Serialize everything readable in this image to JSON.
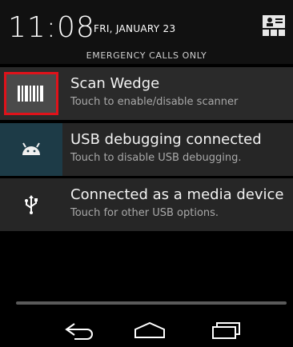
{
  "status_bar": {
    "time": "11:08",
    "date": "FRI, JANUARY 23",
    "emergency": "EMERGENCY CALLS ONLY",
    "quick_settings_icon": "quick-settings-icon"
  },
  "notifications": [
    {
      "icon": "barcode-icon",
      "title": "Scan Wedge",
      "subtitle": "Touch to enable/disable scanner",
      "highlight_color": "#e0121a"
    },
    {
      "icon": "android-icon",
      "title": "USB debugging connected",
      "subtitle": "Touch to disable USB debugging."
    },
    {
      "icon": "usb-icon",
      "title": "Connected as a media device",
      "subtitle": "Touch for other USB options."
    }
  ],
  "navigation": {
    "back_icon": "back-icon",
    "home_icon": "home-icon",
    "recents_icon": "recents-icon"
  },
  "colors": {
    "background": "#000000",
    "notification_bg": "#262626",
    "android_icon_bg": "#1d3b47",
    "highlight": "#e0121a"
  }
}
